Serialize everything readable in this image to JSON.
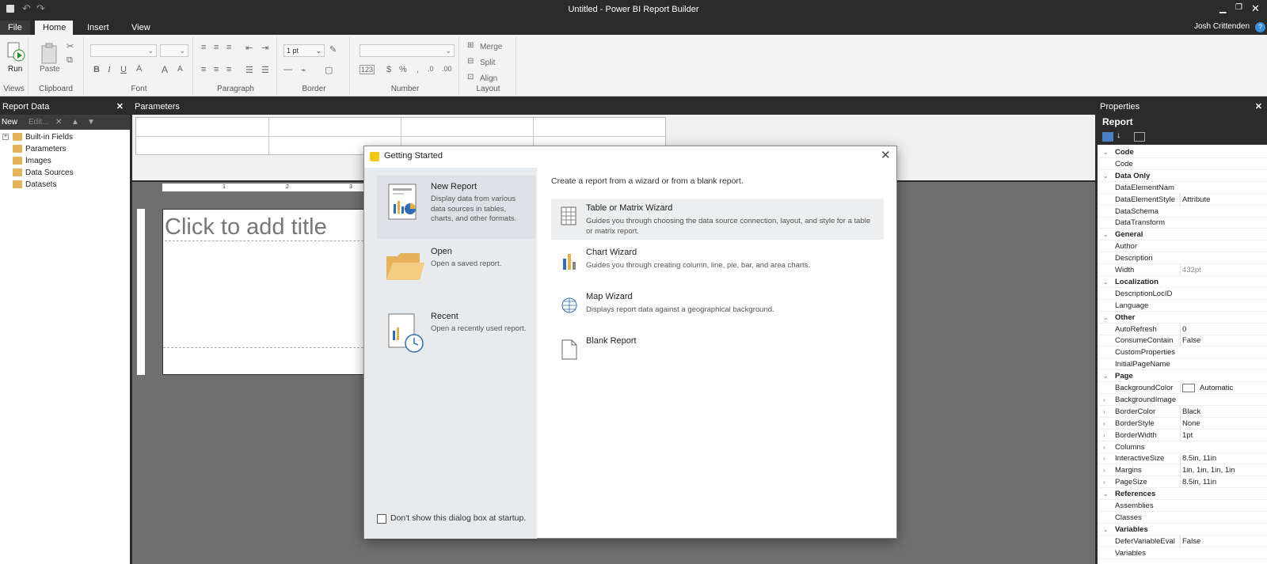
{
  "app": {
    "title": "Untitled - Power BI Report Builder",
    "user": "Josh Crittenden"
  },
  "menu": {
    "file": "File",
    "home": "Home",
    "insert": "Insert",
    "view": "View"
  },
  "ribbon": {
    "run": "Run",
    "paste": "Paste",
    "border_size": "1 pt",
    "merge": "Merge",
    "split": "Split",
    "align": "Align",
    "groups": {
      "views": "Views",
      "clipboard": "Clipboard",
      "font": "Font",
      "paragraph": "Paragraph",
      "border": "Border",
      "number": "Number",
      "layout": "Layout"
    }
  },
  "report_data": {
    "title": "Report Data",
    "new": "New",
    "edit": "Edit...",
    "items": [
      "Built-in Fields",
      "Parameters",
      "Images",
      "Data Sources",
      "Datasets"
    ]
  },
  "parameters": {
    "title": "Parameters"
  },
  "canvas": {
    "title_placeholder": "Click to add title",
    "ruler_marks": [
      "1",
      "2",
      "3"
    ]
  },
  "properties": {
    "title": "Properties",
    "object": "Report",
    "rows": [
      {
        "kind": "cat",
        "name": "Code"
      },
      {
        "kind": "prop",
        "name": "Code",
        "value": ""
      },
      {
        "kind": "cat",
        "name": "Data Only"
      },
      {
        "kind": "prop",
        "name": "DataElementNam",
        "value": ""
      },
      {
        "kind": "prop",
        "name": "DataElementStyle",
        "value": "Attribute"
      },
      {
        "kind": "prop",
        "name": "DataSchema",
        "value": ""
      },
      {
        "kind": "prop",
        "name": "DataTransform",
        "value": ""
      },
      {
        "kind": "cat",
        "name": "General"
      },
      {
        "kind": "prop",
        "name": "Author",
        "value": ""
      },
      {
        "kind": "prop",
        "name": "Description",
        "value": ""
      },
      {
        "kind": "prop",
        "name": "Width",
        "value": "432pt",
        "dim": true
      },
      {
        "kind": "cat",
        "name": "Localization"
      },
      {
        "kind": "prop",
        "name": "DescriptionLocID",
        "value": ""
      },
      {
        "kind": "prop",
        "name": "Language",
        "value": ""
      },
      {
        "kind": "cat",
        "name": "Other"
      },
      {
        "kind": "prop",
        "name": "AutoRefresh",
        "value": "0"
      },
      {
        "kind": "prop",
        "name": "ConsumeContain",
        "value": "False"
      },
      {
        "kind": "prop",
        "name": "CustomProperties",
        "value": ""
      },
      {
        "kind": "prop",
        "name": "InitialPageName",
        "value": ""
      },
      {
        "kind": "cat",
        "name": "Page"
      },
      {
        "kind": "prop",
        "name": "BackgroundColor",
        "value": "Automatic",
        "swatch": true
      },
      {
        "kind": "prop",
        "name": "BackgroundImage",
        "value": "",
        "expand": true
      },
      {
        "kind": "prop",
        "name": "BorderColor",
        "value": "Black",
        "expand": true
      },
      {
        "kind": "prop",
        "name": "BorderStyle",
        "value": "None",
        "expand": true
      },
      {
        "kind": "prop",
        "name": "BorderWidth",
        "value": "1pt",
        "expand": true
      },
      {
        "kind": "prop",
        "name": "Columns",
        "value": "",
        "expand": true
      },
      {
        "kind": "prop",
        "name": "InteractiveSize",
        "value": "8.5in, 11in",
        "expand": true
      },
      {
        "kind": "prop",
        "name": "Margins",
        "value": "1in, 1in, 1in, 1in",
        "expand": true
      },
      {
        "kind": "prop",
        "name": "PageSize",
        "value": "8.5in, 11in",
        "expand": true
      },
      {
        "kind": "cat",
        "name": "References"
      },
      {
        "kind": "prop",
        "name": "Assemblies",
        "value": ""
      },
      {
        "kind": "prop",
        "name": "Classes",
        "value": ""
      },
      {
        "kind": "cat",
        "name": "Variables"
      },
      {
        "kind": "prop",
        "name": "DeferVariableEval",
        "value": "False"
      },
      {
        "kind": "prop",
        "name": "Variables",
        "value": ""
      }
    ]
  },
  "dialog": {
    "title": "Getting Started",
    "intro": "Create a report from a wizard or from a blank report.",
    "nav": [
      {
        "title": "New Report",
        "desc": "Display data from various data sources in tables, charts, and other formats."
      },
      {
        "title": "Open",
        "desc": "Open a saved report."
      },
      {
        "title": "Recent",
        "desc": "Open a recently used report."
      }
    ],
    "options": [
      {
        "title": "Table or Matrix Wizard",
        "desc": "Guides you through choosing the data source connection, layout, and style for a table or matrix report."
      },
      {
        "title": "Chart Wizard",
        "desc": "Guides you through creating column, line, pie, bar, and area charts."
      },
      {
        "title": "Map Wizard",
        "desc": "Displays report data against a geographical background."
      },
      {
        "title": "Blank Report",
        "desc": ""
      }
    ],
    "dont_show": "Don't show this dialog box at startup."
  },
  "colors": {
    "accent": "#1e6fd6",
    "dark": "#2b2b2b",
    "folder": "#e3b25a"
  }
}
